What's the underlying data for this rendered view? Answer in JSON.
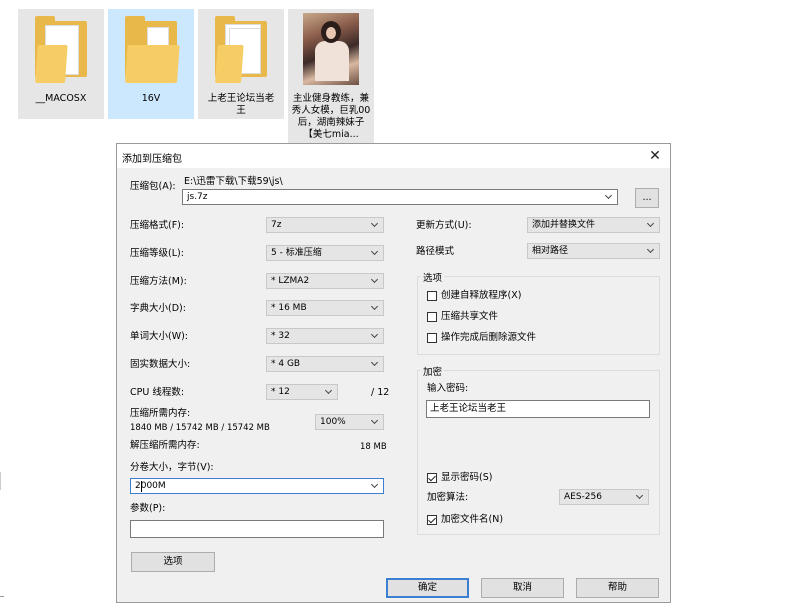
{
  "files": [
    {
      "name": "__MACOSX"
    },
    {
      "name": "16V"
    },
    {
      "name": "上老王论坛当老王"
    },
    {
      "name": "主业健身教练，兼秀人女模，巨乳00后，湖南辣妹子【美七mia..."
    }
  ],
  "dialog": {
    "title": "添加到压缩包",
    "archive": {
      "label": "压缩包(A):",
      "path": "E:\\迅雷下载\\下载59\\js\\",
      "filename": "js.7z",
      "browse_label": "..."
    },
    "left": {
      "format": {
        "label": "压缩格式(F):",
        "value": "7z"
      },
      "level": {
        "label": "压缩等级(L):",
        "value": "5 - 标准压缩"
      },
      "method": {
        "label": "压缩方法(M):",
        "value": "* LZMA2"
      },
      "dict": {
        "label": "字典大小(D):",
        "value": "* 16 MB"
      },
      "word": {
        "label": "单词大小(W):",
        "value": "* 32"
      },
      "solid": {
        "label": "固实数据大小:",
        "value": "* 4 GB"
      },
      "threads": {
        "label": "CPU 线程数:",
        "value": "* 12",
        "max": "/ 12"
      },
      "mem_compress": {
        "label": "压缩所需内存:",
        "detail": "1840 MB / 15742 MB / 15742 MB",
        "percent": "100%"
      },
      "mem_decompress": {
        "label": "解压缩所需内存:",
        "value": "18 MB"
      },
      "split": {
        "label": "分卷大小，字节(V):",
        "value": "2000M"
      },
      "params": {
        "label": "参数(P):",
        "value": ""
      },
      "options_button": "选项"
    },
    "right": {
      "update": {
        "label": "更新方式(U):",
        "value": "添加并替换文件"
      },
      "path_mode": {
        "label": "路径模式",
        "value": "相对路径"
      },
      "options_group": {
        "title": "选项",
        "sfx": "创建自释放程序(X)",
        "shared": "压缩共享文件",
        "delete_after": "操作完成后删除源文件"
      },
      "encryption": {
        "title": "加密",
        "password_label": "输入密码:",
        "password_value": "上老王论坛当老王",
        "show_password": "显示密码(S)",
        "method_label": "加密算法:",
        "method_value": "AES-256",
        "encrypt_names": "加密文件名(N)"
      }
    },
    "buttons": {
      "ok": "确定",
      "cancel": "取消",
      "help": "帮助"
    }
  }
}
